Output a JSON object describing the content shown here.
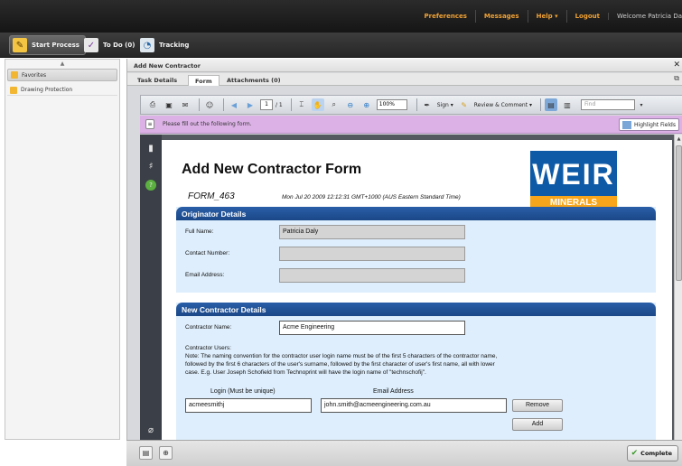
{
  "topnav": {
    "links": [
      "Preferences",
      "Messages",
      "Help ▾",
      "Logout"
    ],
    "welcome": "Welcome Patricia Da"
  },
  "navstrip": {
    "tabs": [
      {
        "label": "Start Process",
        "icon": "start-process-icon",
        "active": true
      },
      {
        "label": "To Do (0)",
        "icon": "todo-icon",
        "active": false
      },
      {
        "label": "Tracking",
        "icon": "tracking-icon",
        "active": false
      }
    ]
  },
  "leftpanel": {
    "favorites": "Favorites",
    "item": "Drawing Protection"
  },
  "workspace": {
    "title": "Add New Contractor",
    "tabs": [
      "Task Details",
      "Form",
      "Attachments (0)"
    ]
  },
  "pdftoolbar": {
    "page_current": "1",
    "page_total": "/ 1",
    "zoom": "100%",
    "sign": "Sign ▾",
    "review": "Review & Comment ▾",
    "find_placeholder": "Find"
  },
  "fillbar": {
    "message": "Please fill out the following form.",
    "highlight": "Highlight Fields"
  },
  "form": {
    "title": "Add New Contractor Form",
    "number": "FORM_463",
    "date": "Mon Jul 20 2009 12:12:31 GMT+1000 (AUS Eastern Standard Time)",
    "logo_text": "WEIR",
    "logo_sub": "MINERALS",
    "originator": {
      "heading": "Originator Details",
      "full_name_label": "Full Name:",
      "full_name_value": "Patricia Daly",
      "contact_label": "Contact Number:",
      "contact_value": "",
      "email_label": "Email Address:",
      "email_value": ""
    },
    "contractor": {
      "heading": "New Contractor Details",
      "name_label": "Contractor Name:",
      "name_value": "Acme Engineering",
      "users_label": "Contractor Users:",
      "note_line1": "Note: The naming convention for the contractor user login name must be of the first 5 characters of the contractor name,",
      "note_line2": "followed by the first 6 characters of the user's surname, followed by the first character of user's first name, all with lower",
      "note_line3": "case. E.g. User Joseph Schofield from Technoprint will have the login name of \"technschofij\".",
      "login_header": "Login (Must be unique)",
      "email_header": "Email Address",
      "login_value": "acmeesmithj",
      "email_value": "john.smith@acmeengineering.com.au",
      "remove_label": "Remove",
      "add_label": "Add"
    }
  },
  "bottombar": {
    "complete_label": "Complete"
  },
  "colors": {
    "accent_orange": "#f1a234",
    "section_blue": "#1f4f93",
    "form_bg": "#deeefc",
    "fillbar_purple": "#dcb2e6"
  }
}
